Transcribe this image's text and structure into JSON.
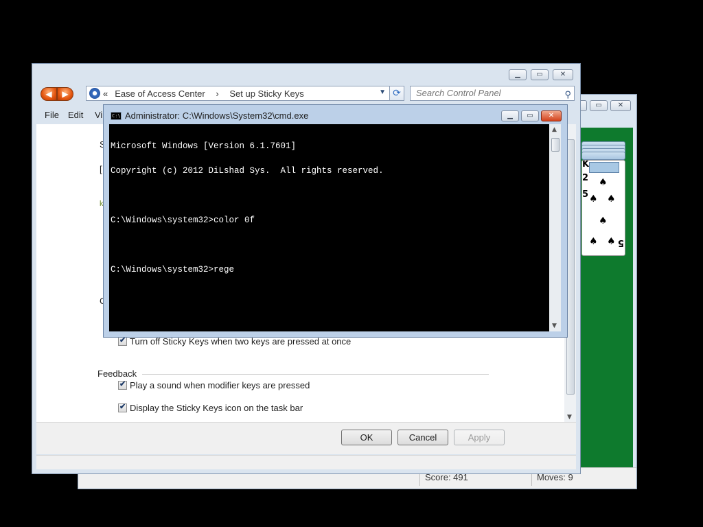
{
  "solitaire": {
    "score": "Score: 491",
    "moves": "Moves:  9",
    "card_ranks": [
      "K",
      "2",
      "5",
      "5"
    ],
    "felt_color": "#0e7a2d"
  },
  "control_panel": {
    "address": {
      "chevrons": "«",
      "crumbs": [
        "Ease of Access Center",
        "Set up Sticky Keys"
      ]
    },
    "search_placeholder": "Search Control Panel",
    "menu": [
      "File",
      "Edit",
      "Vi"
    ],
    "partial_left_chars": [
      "S",
      "[",
      "k",
      "C"
    ],
    "options": {
      "turn_off_two_keys": "Turn off Sticky Keys when two keys are pressed at once",
      "feedback_heading": "Feedback",
      "play_sound": "Play a sound when modifier keys are pressed",
      "display_icon": "Display the Sticky Keys icon on the task bar"
    },
    "buttons": {
      "ok": "OK",
      "cancel": "Cancel",
      "apply": "Apply"
    }
  },
  "cmd": {
    "title": "Administrator: C:\\Windows\\System32\\cmd.exe",
    "icon_text": "C:\\",
    "lines": [
      "Microsoft Windows [Version 6.1.7601]",
      "Copyright (c) 2012 DiLshad Sys.  All rights reserved.",
      "",
      "C:\\Windows\\system32>color 0f",
      "",
      "C:\\Windows\\system32>rege"
    ]
  },
  "colors": {
    "desktop": "#000000",
    "cmd_background": "#000000",
    "cmd_text": "#ffffff",
    "close_button": "#d3421c"
  }
}
